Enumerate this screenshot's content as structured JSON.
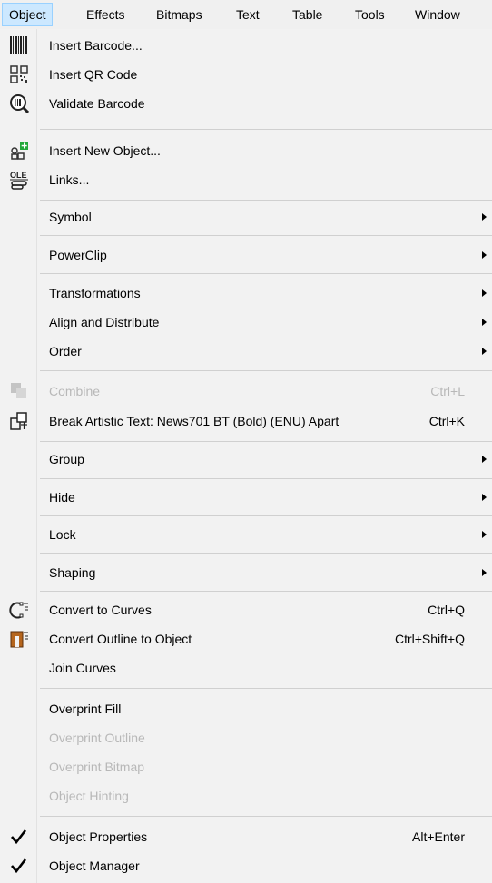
{
  "menubar": {
    "items": [
      {
        "label": "Object"
      },
      {
        "label": "Effects"
      },
      {
        "label": "Bitmaps"
      },
      {
        "label": "Text"
      },
      {
        "label": "Table"
      },
      {
        "label": "Tools"
      },
      {
        "label": "Window"
      }
    ]
  },
  "menu": {
    "items": [
      {
        "label": "Insert Barcode...",
        "icon": "barcode-icon"
      },
      {
        "label": "Insert QR Code",
        "icon": "qr-code-icon"
      },
      {
        "label": "Validate Barcode",
        "icon": "validate-barcode-icon"
      },
      {
        "label": "Insert New Object...",
        "icon": "insert-object-icon"
      },
      {
        "label": "Links...",
        "icon": "ole-links-icon"
      },
      {
        "label": "Symbol",
        "submenu": true
      },
      {
        "label": "PowerClip",
        "submenu": true
      },
      {
        "label": "Transformations",
        "submenu": true
      },
      {
        "label": "Align and Distribute",
        "submenu": true
      },
      {
        "label": "Order",
        "submenu": true
      },
      {
        "label": "Combine",
        "shortcut": "Ctrl+L",
        "disabled": true,
        "icon": "combine-icon"
      },
      {
        "label": "Break Artistic Text: News701 BT (Bold) (ENU) Apart",
        "shortcut": "Ctrl+K",
        "icon": "break-apart-icon"
      },
      {
        "label": "Group",
        "submenu": true
      },
      {
        "label": "Hide",
        "submenu": true
      },
      {
        "label": "Lock",
        "submenu": true
      },
      {
        "label": "Shaping",
        "submenu": true
      },
      {
        "label": "Convert to Curves",
        "shortcut": "Ctrl+Q",
        "icon": "convert-curves-icon"
      },
      {
        "label": "Convert Outline to Object",
        "shortcut": "Ctrl+Shift+Q",
        "icon": "convert-outline-icon"
      },
      {
        "label": "Join Curves"
      },
      {
        "label": "Overprint Fill"
      },
      {
        "label": "Overprint Outline",
        "disabled": true
      },
      {
        "label": "Overprint Bitmap",
        "disabled": true
      },
      {
        "label": "Object Hinting",
        "disabled": true
      },
      {
        "label": "Object Properties",
        "shortcut": "Alt+Enter",
        "checked": true
      },
      {
        "label": "Object Manager",
        "checked": true
      }
    ]
  },
  "colors": {
    "accent": "#cce8ff",
    "accent_border": "#99d1ff",
    "disabled": "#b8b8b8",
    "corner_green": "#22a83a",
    "outline_icon": "#b5651d"
  }
}
